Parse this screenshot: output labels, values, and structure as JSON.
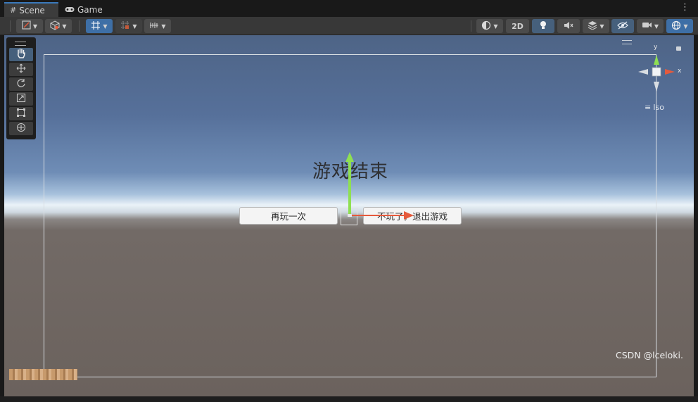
{
  "tabs": [
    {
      "label": "Scene",
      "icon": "grid-hash-icon",
      "active": true
    },
    {
      "label": "Game",
      "icon": "gamepad-icon",
      "active": false
    }
  ],
  "toolbar": {
    "mode_2d_label": "2D"
  },
  "game_ui": {
    "title": "游戏结束",
    "retry_button": "再玩一次",
    "quit_button": "不玩了，退出游戏"
  },
  "gizmo": {
    "y_label": "y",
    "x_label": "x",
    "projection_label": "Iso"
  },
  "watermark": "CSDN @lceloki.",
  "colors": {
    "accent_blue": "#3a79bb",
    "gizmo_x": "#e65a3c",
    "gizmo_y": "#8fe052"
  }
}
